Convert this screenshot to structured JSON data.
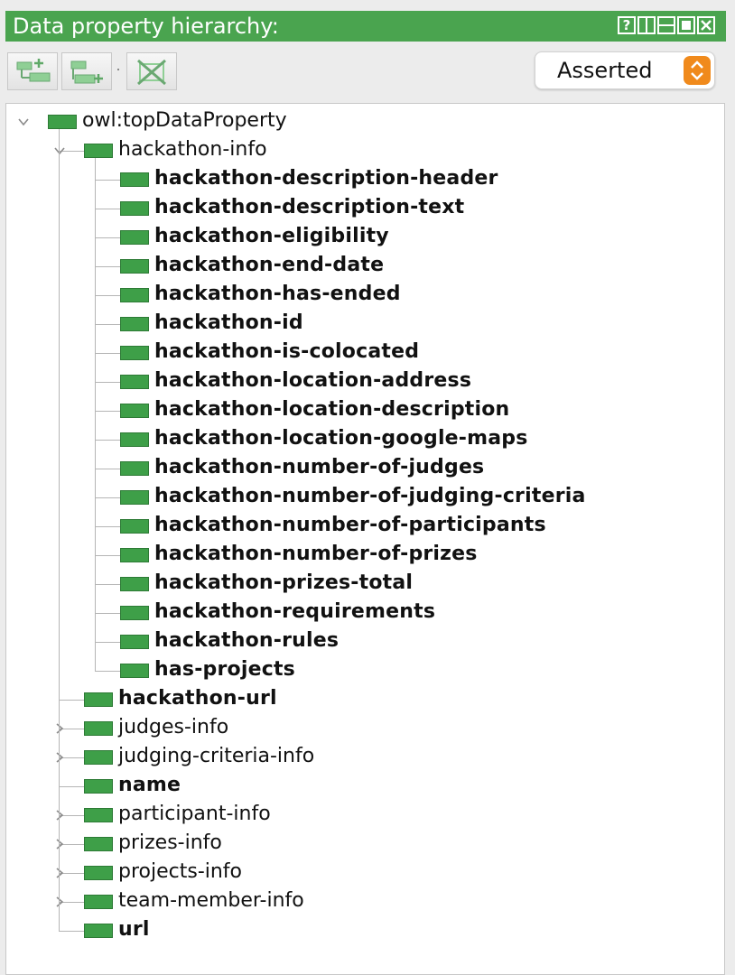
{
  "panel": {
    "title": "Data property hierarchy:",
    "help_label": "?"
  },
  "selector": {
    "value": "Asserted"
  },
  "colors": {
    "header_green": "#4aa44f",
    "property_icon": "#3e9f48",
    "select_accent": "#f08a1c"
  },
  "tree": {
    "root": {
      "label": "owl:topDataProperty",
      "expanded": true
    },
    "children": [
      {
        "label": "hackathon-info",
        "bold": false,
        "expanded": true,
        "has_children": true,
        "children": [
          {
            "label": "hackathon-description-header",
            "bold": true
          },
          {
            "label": "hackathon-description-text",
            "bold": true
          },
          {
            "label": "hackathon-eligibility",
            "bold": true
          },
          {
            "label": "hackathon-end-date",
            "bold": true
          },
          {
            "label": "hackathon-has-ended",
            "bold": true
          },
          {
            "label": "hackathon-id",
            "bold": true
          },
          {
            "label": "hackathon-is-colocated",
            "bold": true
          },
          {
            "label": "hackathon-location-address",
            "bold": true
          },
          {
            "label": "hackathon-location-description",
            "bold": true
          },
          {
            "label": "hackathon-location-google-maps",
            "bold": true
          },
          {
            "label": "hackathon-number-of-judges",
            "bold": true
          },
          {
            "label": "hackathon-number-of-judging-criteria",
            "bold": true
          },
          {
            "label": "hackathon-number-of-participants",
            "bold": true
          },
          {
            "label": "hackathon-number-of-prizes",
            "bold": true
          },
          {
            "label": "hackathon-prizes-total",
            "bold": true
          },
          {
            "label": "hackathon-requirements",
            "bold": true
          },
          {
            "label": "hackathon-rules",
            "bold": true
          },
          {
            "label": "has-projects",
            "bold": true
          }
        ]
      },
      {
        "label": "hackathon-url",
        "bold": true,
        "has_children": false
      },
      {
        "label": "judges-info",
        "bold": false,
        "has_children": true,
        "expanded": false
      },
      {
        "label": "judging-criteria-info",
        "bold": false,
        "has_children": true,
        "expanded": false
      },
      {
        "label": "name",
        "bold": true,
        "has_children": false
      },
      {
        "label": "participant-info",
        "bold": false,
        "has_children": true,
        "expanded": false
      },
      {
        "label": "prizes-info",
        "bold": false,
        "has_children": true,
        "expanded": false
      },
      {
        "label": "projects-info",
        "bold": false,
        "has_children": true,
        "expanded": false
      },
      {
        "label": "team-member-info",
        "bold": false,
        "has_children": true,
        "expanded": false
      },
      {
        "label": "url",
        "bold": true,
        "has_children": false
      }
    ]
  }
}
